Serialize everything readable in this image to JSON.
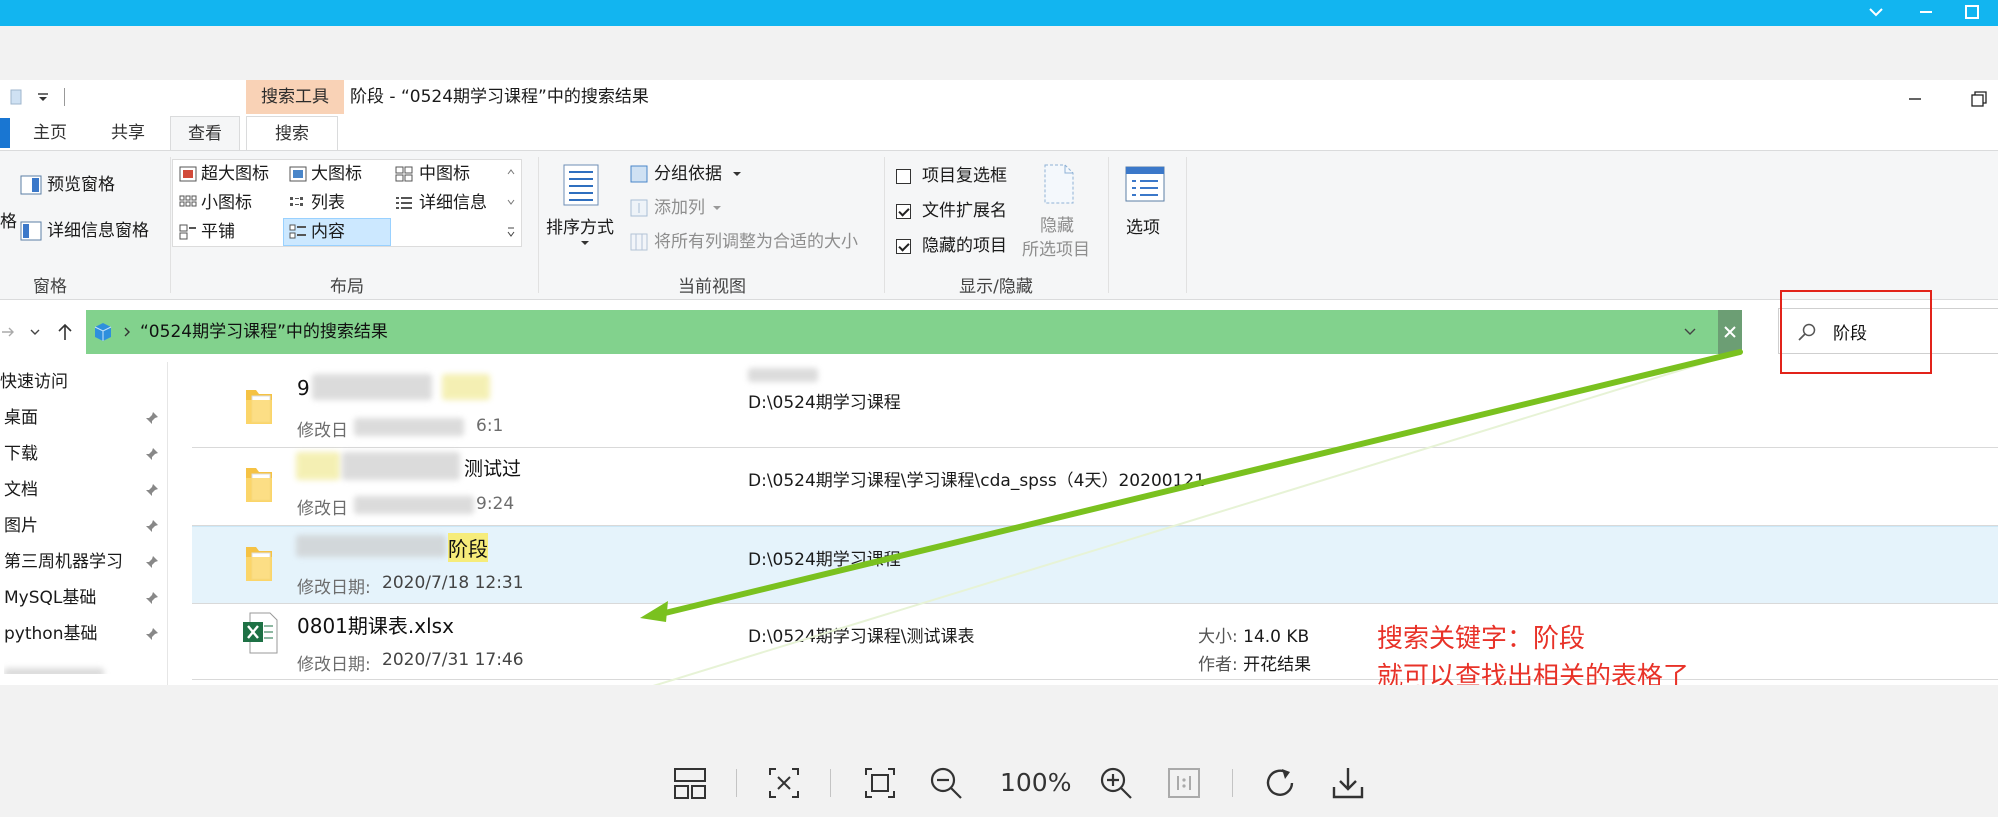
{
  "titlebar": {
    "context_tab": "搜索工具",
    "title": "阶段 - “0524期学习课程”中的搜索结果"
  },
  "tabs": [
    {
      "label": "主页"
    },
    {
      "label": "共享"
    },
    {
      "label": "查看"
    },
    {
      "label": "搜索"
    }
  ],
  "ribbon": {
    "pane": {
      "cut_label": "格",
      "preview": "预览窗格",
      "details": "详细信息窗格",
      "group": "窗格"
    },
    "layout": {
      "items": [
        "超大图标",
        "大图标",
        "中图标",
        "小图标",
        "列表",
        "详细信息",
        "平铺",
        "内容"
      ],
      "selected": "内容",
      "group": "布局"
    },
    "current_view": {
      "sort": "排序方式",
      "group_by": "分组依据",
      "add_column": "添加列",
      "fit_columns": "将所有列调整为合适的大小",
      "group": "当前视图"
    },
    "show_hide": {
      "item_checkbox": "项目复选框",
      "item_checkbox_checked": false,
      "file_ext": "文件扩展名",
      "file_ext_checked": true,
      "hidden_items": "隐藏的项目",
      "hidden_items_checked": true,
      "hide_selected_line1": "隐藏",
      "hide_selected_line2": "所选项目",
      "group": "显示/隐藏"
    },
    "options": "选项"
  },
  "address": {
    "breadcrumb": "“0524期学习课程”中的搜索结果"
  },
  "search": {
    "value": "阶段"
  },
  "nav": {
    "items": [
      {
        "label": "快速访问",
        "pinned": false
      },
      {
        "label": "桌面",
        "pinned": true
      },
      {
        "label": "下载",
        "pinned": true
      },
      {
        "label": "文档",
        "pinned": true
      },
      {
        "label": "图片",
        "pinned": true
      },
      {
        "label": "第三周机器学习",
        "pinned": true
      },
      {
        "label": "MySQL基础",
        "pinned": true
      },
      {
        "label": "python基础",
        "pinned": true
      }
    ]
  },
  "results": [
    {
      "name_visible": "9",
      "date_label": "修改日",
      "date_visible": "6:1",
      "path": "D:\\0524期学习课程"
    },
    {
      "name_visible": "测试过",
      "date_label": "修改日",
      "date_visible": "9:24",
      "path": "D:\\0524期学习课程\\学习课程\\cda_spss（4天）20200121"
    },
    {
      "name_visible": "阶段",
      "date_label": "修改日期:",
      "date": "2020/7/18 12:31",
      "path": "D:\\0524期学习课程"
    },
    {
      "name": "0801期课表.xlsx",
      "date_label": "修改日期:",
      "date": "2020/7/31 17:46",
      "path": "D:\\0524期学习课程\\测试课表",
      "size_label": "大小:",
      "size": "14.0 KB",
      "author_label": "作者:",
      "author": "开花结果"
    }
  ],
  "annotation": {
    "line1": "搜索关键字：阶段",
    "line2": "就可以查找出相关的表格了"
  },
  "viewer": {
    "zoom": "100%"
  },
  "colors": {
    "topbar": "#12b5f0",
    "address_highlight": "#82d28d",
    "annotation": "#e83228",
    "arrow": "#7ac11f",
    "selection": "#e5f3fb"
  }
}
